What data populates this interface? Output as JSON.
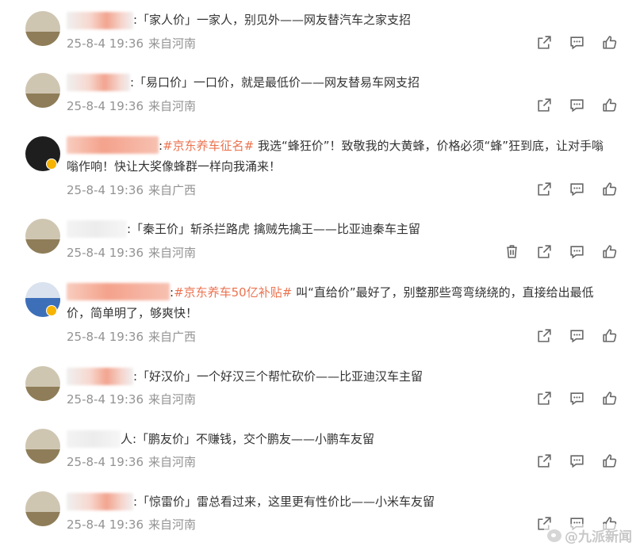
{
  "comments": [
    {
      "text": ":「家人价」一家人，别见外——网友替汽车之家支招",
      "date": "25-8-4 19:36",
      "location": "来自河南"
    },
    {
      "text": ":「易口价」一口价，就是最低价——网友替易车网支招",
      "date": "25-8-4 19:36",
      "location": "来自河南"
    },
    {
      "tag": "#京东养车征名#",
      "text": " 我选“蜂狂价”！致敬我的大黄蜂，价格必须“蜂”狂到底，让对手嗡嗡作响！快让大奖像蜂群一样向我涌来！",
      "date": "25-8-4 19:36",
      "location": "来自广西"
    },
    {
      "text": ":「秦王价」斩杀拦路虎 擒贼先擒王——比亚迪秦车主留",
      "date": "25-8-4 19:36",
      "location": "来自河南"
    },
    {
      "tag": "#京东养车50亿补贴#",
      "text": " 叫“直给价”最好了，别整那些弯弯绕绕的，直接给出最低价，简单明了，够爽快！",
      "date": "25-8-4 19:36",
      "location": "来自广西"
    },
    {
      "text": ":「好汉价」一个好汉三个帮忙砍价——比亚迪汉车主留",
      "date": "25-8-4 19:36",
      "location": "来自河南"
    },
    {
      "text": "人:「鹏友价」不赚钱，交个鹏友——小鹏车友留",
      "date": "25-8-4 19:36",
      "location": "来自河南"
    },
    {
      "text": ":「惊雷价」雷总看过来，这里更有性价比——小米车友留",
      "date": "25-8-4 19:36",
      "location": "来自河南"
    }
  ],
  "actions": {
    "share_icon": "share-icon",
    "comment_icon": "comment-icon",
    "like_icon": "thumbs-up-icon",
    "delete_icon": "trash-icon"
  },
  "watermark": {
    "text": "@九派新闻",
    "logo": "weibo-logo-icon"
  },
  "colors": {
    "tag": "#eb7350",
    "meta": "#939393",
    "icon": "#666666"
  }
}
